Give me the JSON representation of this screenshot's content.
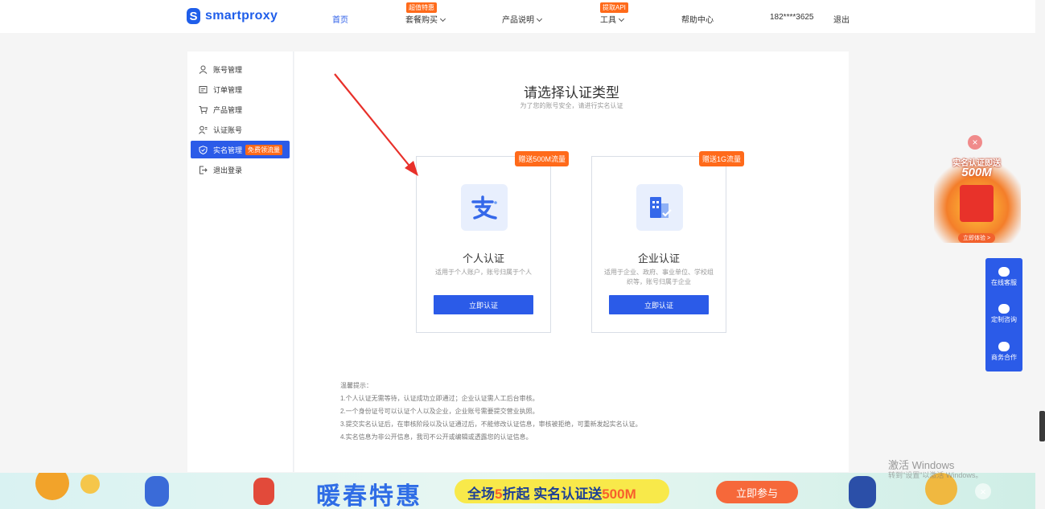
{
  "nav": {
    "logo_text": "smartproxy",
    "items": [
      {
        "label": "首页",
        "active": true
      },
      {
        "label": "套餐购买",
        "badge": "超值特惠",
        "caret": true
      },
      {
        "label": "产品说明",
        "caret": true
      },
      {
        "label": "工具",
        "badge": "提取API",
        "caret": true
      },
      {
        "label": "帮助中心"
      }
    ],
    "phone": "182****3625",
    "logout": "退出"
  },
  "sidebar": {
    "items": [
      {
        "label": "账号管理",
        "icon": "user-icon"
      },
      {
        "label": "订单管理",
        "icon": "order-icon"
      },
      {
        "label": "产品管理",
        "icon": "cart-icon"
      },
      {
        "label": "认证账号",
        "icon": "user-list-icon"
      },
      {
        "label": "实名管理",
        "icon": "shield-icon",
        "tag": "免费领流量",
        "active": true
      },
      {
        "label": "退出登录",
        "icon": "logout-icon"
      }
    ]
  },
  "main": {
    "title": "请选择认证类型",
    "subtitle": "为了您的账号安全，请进行实名认证",
    "cards": [
      {
        "badge": "赠送500M流量",
        "icon": "alipay-icon",
        "title": "个人认证",
        "desc": "适用于个人账户，账号归属于个人",
        "button": "立即认证"
      },
      {
        "badge": "赠送1G流量",
        "icon": "building-icon",
        "title": "企业认证",
        "desc": "适用于企业、政府、事业单位、学校组织等，账号归属于企业",
        "button": "立即认证"
      }
    ],
    "tips": [
      "温馨提示：",
      "1.个人认证无需等待，认证成功立即通过；企业认证需人工后台审核。",
      "2.一个身份证号可以认证个人以及企业，企业账号需要提交营业执照。",
      "3.提交实名认证后，在审核阶段以及认证通过后，不能修改认证信息，审核被拒绝，可重新发起实名认证。",
      "4.实名信息为非公开信息，我司不公开或编辑或透露您的认证信息。"
    ]
  },
  "promo": {
    "headline": "实名认证即送",
    "amount": "500M",
    "button": "立即体验 >"
  },
  "service": {
    "items": [
      {
        "label": "在线客服"
      },
      {
        "label": "定制咨询"
      },
      {
        "label": "商务合作"
      }
    ]
  },
  "banner": {
    "title": "暖春特惠",
    "slogan_prefix": "全场",
    "slogan_highlight": "5",
    "slogan_mid": "折起  实名认证送",
    "slogan_amount": "500M",
    "button": "立即参与"
  },
  "watermark": {
    "title": "激活 Windows",
    "subtitle": "转到\"设置\"以激活 Windows。"
  },
  "colors": {
    "brand_blue": "#2b5be8",
    "accent_orange": "#ff6a1a",
    "arrow_red": "#e8302a"
  }
}
